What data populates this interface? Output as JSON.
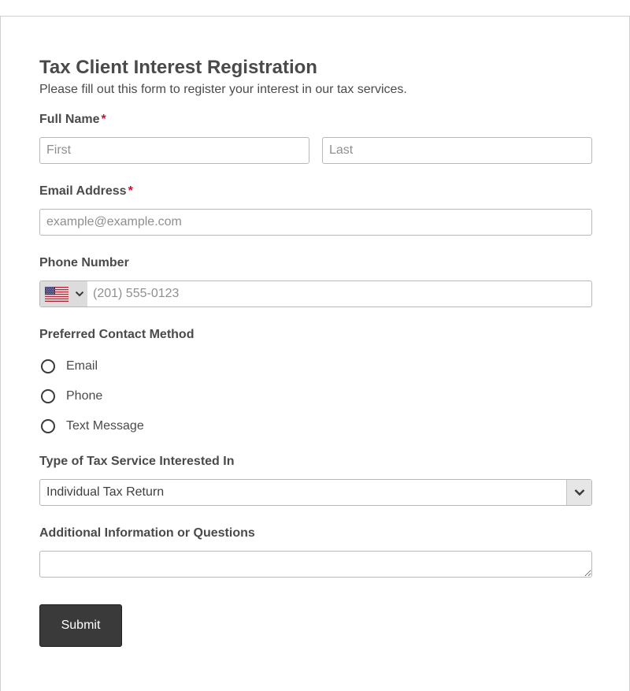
{
  "form": {
    "title": "Tax Client Interest Registration",
    "subtitle": "Please fill out this form to register your interest in our tax services.",
    "required_marker": "*",
    "accent_color": "#c8102e",
    "button_color": "#3a3a3a"
  },
  "full_name": {
    "label": "Full Name",
    "required": true,
    "first_placeholder": "First",
    "last_placeholder": "Last"
  },
  "email": {
    "label": "Email Address",
    "required": true,
    "placeholder": "example@example.com"
  },
  "phone": {
    "label": "Phone Number",
    "country_flag": "us-flag-icon",
    "placeholder": "(201) 555-0123"
  },
  "contact_method": {
    "label": "Preferred Contact Method",
    "options": [
      "Email",
      "Phone",
      "Text Message"
    ],
    "selected": null
  },
  "service_type": {
    "label": "Type of Tax Service Interested In",
    "selected": "Individual Tax Return"
  },
  "additional_info": {
    "label": "Additional Information or Questions",
    "value": ""
  },
  "submit": {
    "label": "Submit"
  }
}
